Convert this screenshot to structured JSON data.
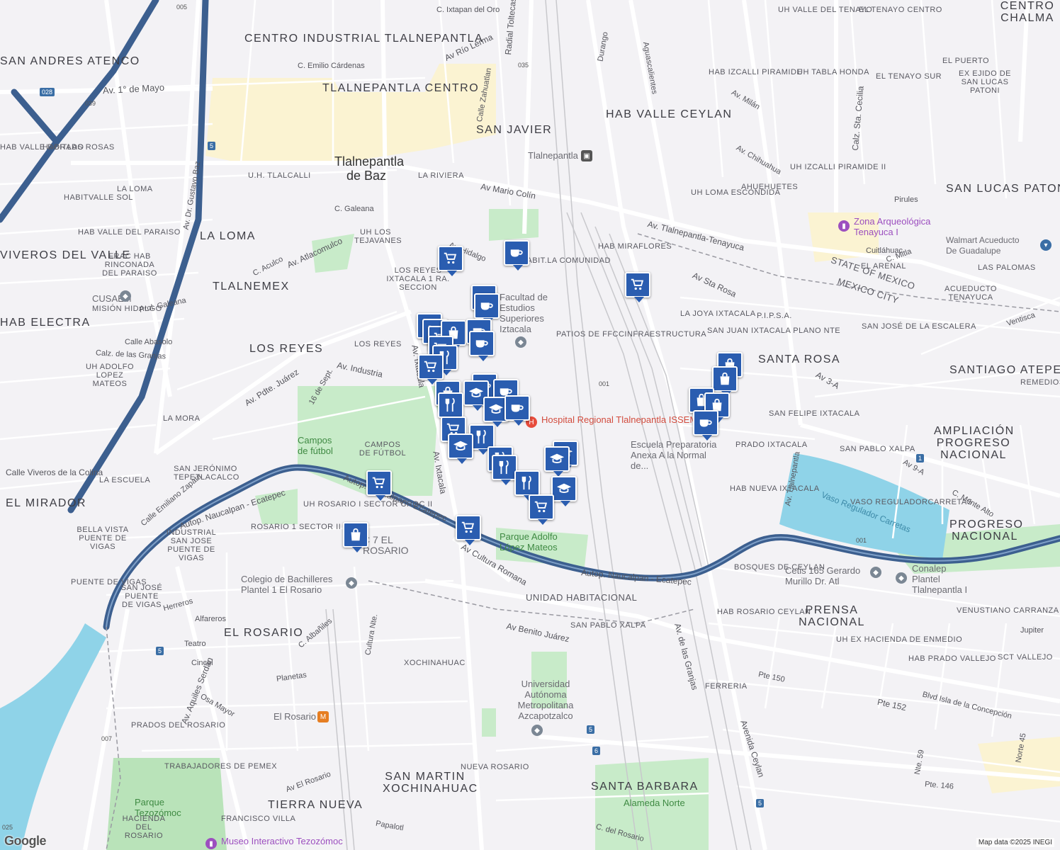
{
  "map": {
    "attribution": "Map data ©2025 INEGI",
    "logo": "Google",
    "colors": {
      "water": "#8fd3e8",
      "park": "#c8ebc9",
      "highway": "#3c5f8f",
      "road": "#ffffff",
      "marker": "#2a5db0"
    },
    "neighborhoods": [
      "CENTRO INDUSTRIAL TLALNEPANTLA",
      "TLALNEPANTLA CENTRO",
      "SAN JAVIER",
      "HAB VALLE CEYLAN",
      "LA LOMA",
      "TLALNEMEX",
      "LOS REYES",
      "LOS REYES IXTACALA 1 RA. SECCION",
      "SAN ANDRES ATENCO",
      "VIVEROS DEL VALLE",
      "HAB ELECTRA",
      "EL MIRADOR",
      "SANTA ROSA",
      "SANTIAGO ATEPETLAC",
      "SAN LUCAS PATONI",
      "AMPLIACIÓN PROGRESO NACIONAL",
      "PROGRESO NACIONAL",
      "PRENSA NACIONAL",
      "EL ROSARIO",
      "SAN MARTIN XOCHINAHUAC",
      "TIERRA NUEVA",
      "SANTA BARBARA",
      "UNIDAD HABITACIONAL",
      "CENTRO CHALMA"
    ],
    "small_areas": [
      "UH VALLE DEL TENAYO",
      "EL TENAYO CENTRO",
      "EL PUERTO",
      "UH TABLA HONDA",
      "EL TENAYO SUR",
      "EX EJIDO DE SAN LUCAS PATONI",
      "HAB IZCALLI PIRAMIDE",
      "UH IZCALLI PIRAMIDE II",
      "AHUEHUETES",
      "UH LOMA ESCONDIDA",
      "HAB MIRAFLORES",
      "HABIT.LA COMUNIDAD",
      "LA JOYA IXTACALA",
      "SAN JUAN IXTACALA PLANO NTE",
      "SAN FELIPE IXTACALA",
      "PRADO IXTACALA",
      "HAB NUEVA IXTACALA",
      "SAN PABLO XALPA",
      "VASO REGULADORCARRETAS",
      "BOSQUES DE CEYLAN",
      "HAB ROSARIO CEYLAN",
      "UH EX HACIENDA DE ENMEDIO",
      "HAB PRADO VALLEJO",
      "SCT VALLEJO",
      "VENUSTIANO CARRANZA",
      "FERRERIA",
      "NUEVA ROSARIO",
      "XOCHINAHUAC",
      "SAN PABLO XALPA",
      "PRADOS DEL ROSARIO",
      "TRABAJADORES DE PEMEX",
      "FRANCISCO VILLA",
      "UH ROSARIO I SECTOR CROC II",
      "ROSARIO 1 SECTOR II CA",
      "INDUSTRIAL SAN JOSE PUENTE DE VIGAS",
      "BELLA VISTA PUENTE DE VIGAS",
      "PUENTE DE VIGAS",
      "SAN JOSÉ PUENTE DE VIGAS",
      "SAN JERÓNIMO TEPETLACALCO",
      "LA ESCUELA",
      "LA MORA",
      "HAB VALLE DEL PARAISO",
      "FRAC HAB RINCONADA DEL PARAISO",
      "HABITVALLE SOL",
      "LA LOMA",
      "UH LOS TEJAVANES",
      "U.H. TLALCALLI",
      "LA RIVIERA",
      "HAB VALLE DORADO",
      "HABITLAS ROSAS",
      "MISIÓN HIDALGO",
      "UH ADOLFO LOPEZ MATEOS",
      "PATIOS DE FFCCINFRAESTRUCTURA",
      "P.I.P.S.A.",
      "EL ARENAL",
      "LAS PALOMAS",
      "ACUEDUCTO TENAYUCA",
      "SAN JOSÉ DE LA ESCALERA",
      "REMEDIOS",
      "STATE OF MEXICO",
      "MEXICO CITY",
      "LOS REYES"
    ],
    "city": "Tlalnepantla de Baz",
    "streets": [
      "Av. 1° de Mayo",
      "Av. Dr. Gustavo Baz",
      "Av. Hidalgo",
      "Av Mario Colín",
      "Av. Tlalnepantla-Tenayuca",
      "Av Sta Rosa",
      "Av. Industria",
      "Av. Pdte. Juárez",
      "Av. Atlacomulco",
      "Autop. Naucalpan - Ecatepec",
      "Av Cultura Romana",
      "Av Benito Juárez",
      "Av. Aquiles Serdán",
      "Av. de las Granjas",
      "Avenida Ceylan",
      "Av. Tlalnepantla",
      "Calz. Sta. Cecilia",
      "Av Río Lerma",
      "Radial Toltecas",
      "Av. Ixtacala",
      "Av El Rosario",
      "Blvd Isla de la Concepción",
      "Pte 152",
      "Pte 150",
      "Pte. 146",
      "Nte. 59",
      "Norte 45",
      "Durango",
      "Aguascalientes",
      "Calle Zahuatlan",
      "Av. Chihuahua",
      "Av. Milán",
      "C. Emilio Cárdenas",
      "C. Ixtapan del Oro",
      "C. Galeana",
      "Prol. Galeana",
      "Calle Abasolo",
      "Calz. de las Granjas",
      "Calle Viveros de la Colina",
      "Calle Emiliano Zapata",
      "16 de Sept.",
      "C. Aculco",
      "Teatro",
      "Cincel",
      "Planetas",
      "Alfareros",
      "Herreros",
      "Osa Mayor",
      "C. Albañiles",
      "Cultura Nte.",
      "C. del Rosario",
      "Papalotl",
      "Ventisca",
      "Jupiter",
      "C. Mitla",
      "Cuitláhuac",
      "Pirules",
      "Av 3-A",
      "Av 9-A",
      "C. Monte Alto",
      "Vaso Regulador Carretas"
    ],
    "pois": [
      {
        "name": "Hospital Regional Tlalnepantla ISSEMyM",
        "icon": "hospital-icon",
        "color": "#e74c3c"
      },
      {
        "name": "Facultad de Estudios Superiores Iztacala",
        "icon": "school-icon",
        "color": "#7b8794"
      },
      {
        "name": "Escuela Preparatoria Anexa A la Normal de...",
        "icon": "school-icon",
        "color": "#7b8794"
      },
      {
        "name": "Zona Arqueológica Tenayuca I",
        "icon": "museum-icon",
        "color": "#9c4fbf"
      },
      {
        "name": "Walmart Acueducto De Guadalupe",
        "icon": "shop-icon",
        "color": "#3a6ea5"
      },
      {
        "name": "CUSAEM",
        "icon": "school-icon",
        "color": "#7b8794"
      },
      {
        "name": "Campos de fútbol",
        "icon": "park-icon",
        "color": "#5ba35e"
      },
      {
        "name": "CAMPOS DE FÚTBOL",
        "icon": "park-icon",
        "color": "#5ba35e"
      },
      {
        "name": "Parque Adolfo López Mateos",
        "icon": "park-icon",
        "color": "#5ba35e"
      },
      {
        "name": "Colegio de Bachilleres Plantel 1 El Rosario",
        "icon": "school-icon",
        "color": "#7b8794"
      },
      {
        "name": "Cetis 165 Gerardo Murillo Dr. Atl",
        "icon": "school-icon",
        "color": "#7b8794"
      },
      {
        "name": "Conalep Plantel Tlalnepantla I",
        "icon": "school-icon",
        "color": "#7b8794"
      },
      {
        "name": "Universidad Autónoma Metropolitana Azcapotzalco",
        "icon": "school-icon",
        "color": "#7b8794"
      },
      {
        "name": "Parque Tezozómoc",
        "icon": "park-icon",
        "color": "#5ba35e"
      },
      {
        "name": "HACIENDA DEL ROSARIO",
        "icon": "none",
        "color": "#5ba35e"
      },
      {
        "name": "Museo Interactivo Tezozómoc",
        "icon": "museum-icon",
        "color": "#9c4fbf"
      },
      {
        "name": "Alameda Norte",
        "icon": "park-icon",
        "color": "#5ba35e"
      },
      {
        "name": "Tlalnepantla",
        "icon": "train-icon",
        "color": "#555"
      },
      {
        "name": "El Rosario",
        "icon": "metro-icon",
        "color": "#e67e22"
      },
      {
        "name": "C 7 EL ROSARIO",
        "icon": "none",
        "color": "#555"
      }
    ],
    "route_shields": [
      "005",
      "028",
      "039",
      "5",
      "035",
      "001",
      "5",
      "6",
      "5",
      "007",
      "1",
      "025"
    ]
  }
}
